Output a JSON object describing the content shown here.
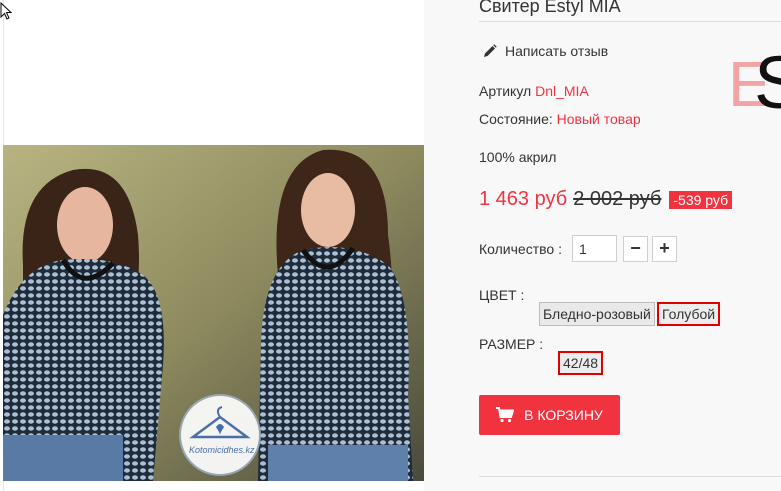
{
  "product": {
    "title": "Свитер Estyl MIA",
    "review_link": "Написать отзыв",
    "article_label": "Артикул",
    "article_value": "Dnl_MIA",
    "condition_label": "Состояние:",
    "condition_value": "Новый товар",
    "composition": "100% акрил",
    "price_new": "1 463 руб",
    "price_old": "2 002 руб",
    "discount": "-539 руб",
    "quantity_label": "Количество :",
    "quantity_value": "1",
    "quantity_minus": "−",
    "quantity_plus": "+",
    "color_label": "ЦВЕТ :",
    "color_options": [
      "Бледно-розовый",
      "Голубой"
    ],
    "color_selected": "Голубой",
    "size_label": "РАЗМЕР :",
    "size_options": [
      "42/48"
    ],
    "size_selected": "42/48",
    "cart_button": "В КОРЗИНУ"
  },
  "brand_logo": {
    "letter1": "E",
    "letter2": "S"
  },
  "watermark": "Kotomicidhes.kz",
  "colors": {
    "accent": "#f13340",
    "selected_border": "#e00000",
    "logo_pink": "#f4a3a5"
  }
}
